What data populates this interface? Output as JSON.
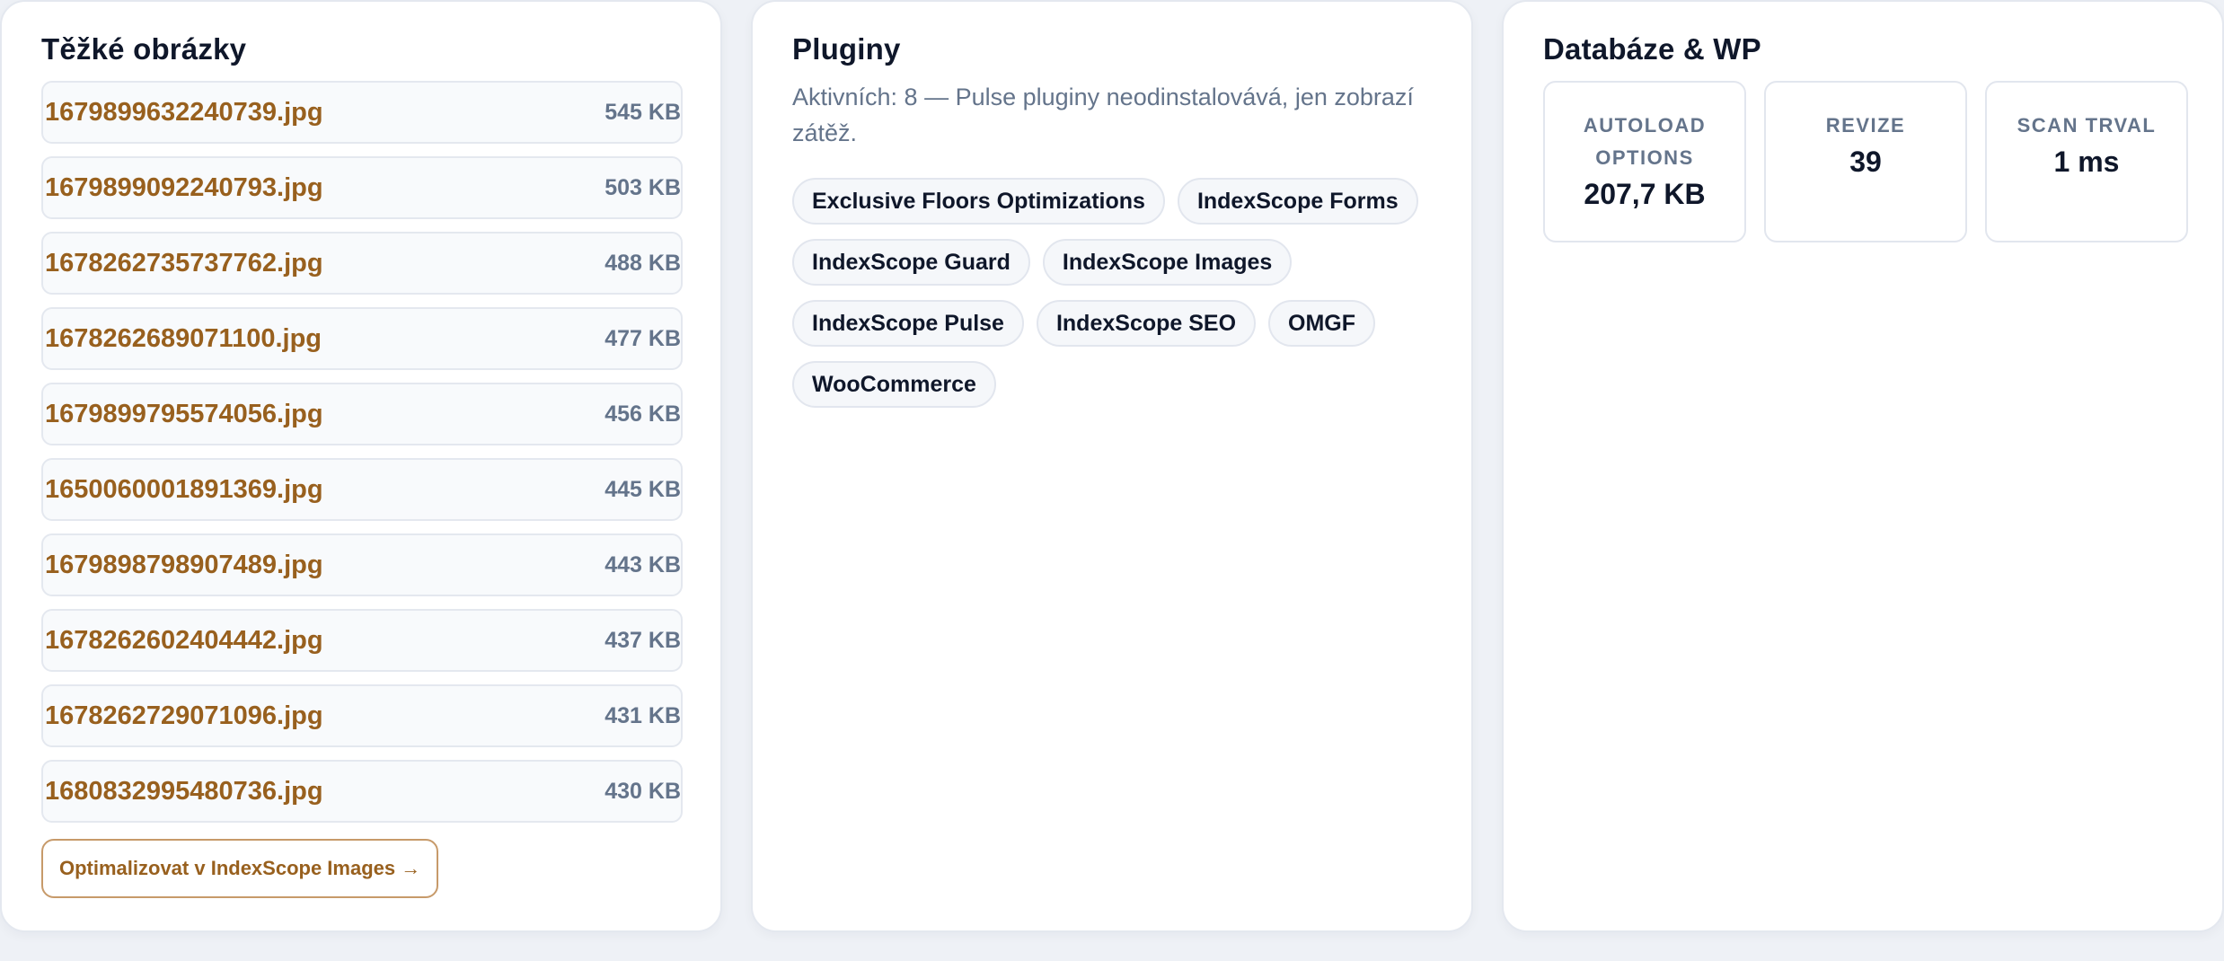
{
  "images_card": {
    "title": "Těžké obrázky",
    "items": [
      {
        "name": "1679899632240739.jpg",
        "size": "545 KB"
      },
      {
        "name": "1679899092240793.jpg",
        "size": "503 KB"
      },
      {
        "name": "1678262735737762.jpg",
        "size": "488 KB"
      },
      {
        "name": "1678262689071100.jpg",
        "size": "477 KB"
      },
      {
        "name": "1679899795574056.jpg",
        "size": "456 KB"
      },
      {
        "name": "1650060001891369.jpg",
        "size": "445 KB"
      },
      {
        "name": "1679898798907489.jpg",
        "size": "443 KB"
      },
      {
        "name": "1678262602404442.jpg",
        "size": "437 KB"
      },
      {
        "name": "1678262729071096.jpg",
        "size": "431 KB"
      },
      {
        "name": "1680832995480736.jpg",
        "size": "430 KB"
      }
    ],
    "cta_label": "Optimalizovat v IndexScope Images →"
  },
  "plugins_card": {
    "title": "Pluginy",
    "subtitle": "Aktivních: 8 — Pulse pluginy neodinstalovává, jen zobrazí zátěž.",
    "plugins": [
      "Exclusive Floors Optimizations",
      "IndexScope Forms",
      "IndexScope Guard",
      "IndexScope Images",
      "IndexScope Pulse",
      "IndexScope SEO",
      "OMGF",
      "WooCommerce"
    ]
  },
  "db_card": {
    "title": "Databáze & WP",
    "stats": [
      {
        "label": "Autoload options",
        "value": "207,7 KB"
      },
      {
        "label": "Revize",
        "value": "39"
      },
      {
        "label": "Scan trval",
        "value": "1 ms"
      }
    ]
  },
  "colors": {
    "accent": "#98601e",
    "muted": "#64748b",
    "heading": "#0f172a",
    "background": "#eef1f6"
  }
}
